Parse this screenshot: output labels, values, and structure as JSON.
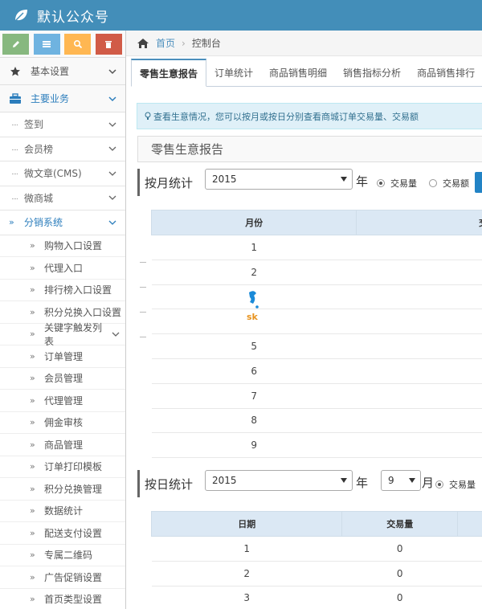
{
  "header": {
    "title": "默认公众号"
  },
  "shortcuts": [
    {
      "name": "pencil-icon",
      "color": "#87b87f"
    },
    {
      "name": "list-icon",
      "color": "#6fb3e0"
    },
    {
      "name": "search-icon",
      "color": "#ffb752"
    },
    {
      "name": "trash-icon",
      "color": "#d15b47"
    }
  ],
  "sidebar": {
    "basic": "基本设置",
    "main": "主要业务",
    "subs": [
      "签到",
      "会员榜",
      "微文章(CMS)",
      "微商城"
    ],
    "distribution": "分销系统",
    "third": [
      "购物入口设置",
      "代理入口",
      "排行榜入口设置",
      "积分兑换入口设置",
      "关键字触发列表",
      "订单管理",
      "会员管理",
      "代理管理",
      "佣金审核",
      "商品管理",
      "订单打印模板",
      "积分兑换管理",
      "数据统计",
      "配送支付设置",
      "专属二维码",
      "广告促销设置",
      "首页类型设置"
    ]
  },
  "breadcrumb": {
    "home": "首页",
    "current": "控制台"
  },
  "tabs": [
    "零售生意报告",
    "订单统计",
    "商品销售明细",
    "销售指标分析",
    "商品销售排行",
    "商品"
  ],
  "alert": "查看生意情况，您可以按月或按日分别查看商城订单交易量、交易额",
  "panel_title": "零售生意报告",
  "monthly": {
    "label": "按月统计",
    "year": "2015",
    "year_unit": "年",
    "radio_volume": "交易量",
    "radio_amount": "交易额",
    "col_month": "月份",
    "col_partial": "交",
    "rows": [
      "1",
      "2",
      "",
      "",
      "5",
      "6",
      "7",
      "8",
      "9"
    ]
  },
  "daily": {
    "label": "按日统计",
    "year": "2015",
    "year_unit": "年",
    "month": "9",
    "month_unit": "月",
    "radio_volume": "交易量",
    "col_date": "日期",
    "col_volume": "交易量",
    "rows": [
      {
        "date": "1",
        "volume": "0"
      },
      {
        "date": "2",
        "volume": "0"
      },
      {
        "date": "3",
        "volume": "0"
      }
    ]
  },
  "logo_text": "sk"
}
